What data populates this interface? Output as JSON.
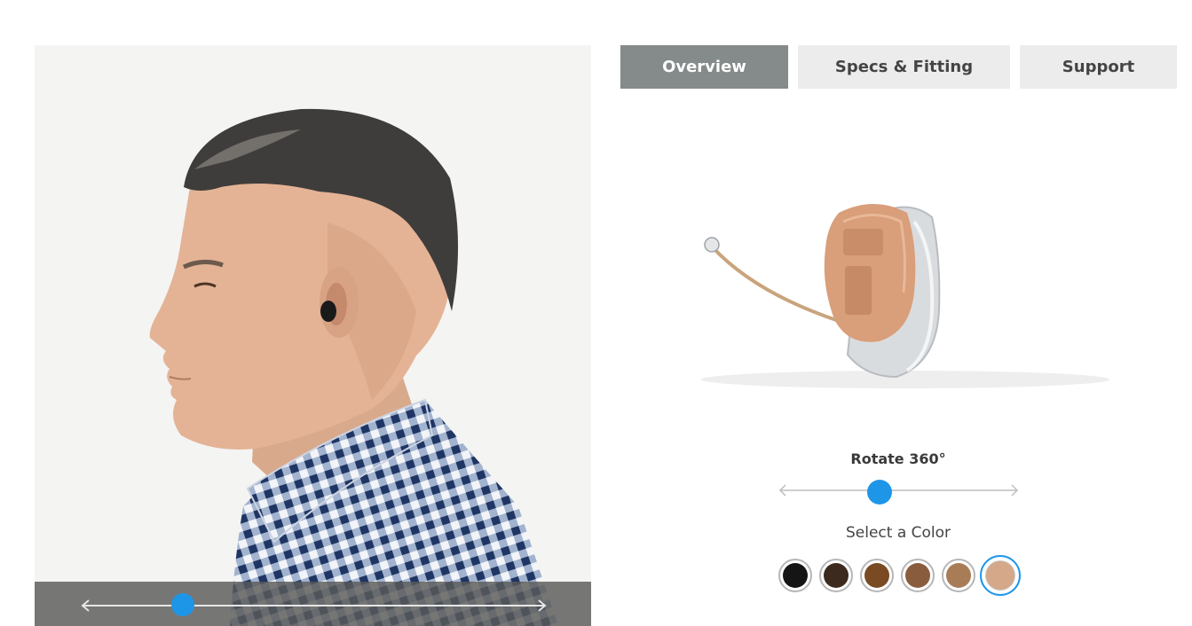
{
  "tabs": [
    {
      "label": "Overview",
      "active": true
    },
    {
      "label": "Specs & Fitting",
      "active": false
    },
    {
      "label": "Support",
      "active": false
    }
  ],
  "photo": {
    "subject": "man-profile-with-hearing-aid",
    "slider_position": 0.22
  },
  "rotate": {
    "label": "Rotate 360°",
    "position": 0.43
  },
  "color_picker": {
    "label": "Select a Color",
    "swatches": [
      {
        "name": "black",
        "color": "#151515"
      },
      {
        "name": "dark-brown",
        "color": "#3b2a1d"
      },
      {
        "name": "brown",
        "color": "#7a4a22"
      },
      {
        "name": "medium-brown",
        "color": "#8a5c3e"
      },
      {
        "name": "light-brown",
        "color": "#a97c58"
      },
      {
        "name": "beige",
        "color": "#d4a888",
        "selected": true
      }
    ]
  },
  "colors": {
    "accent": "#1e96e8",
    "tab_active": "#858a8a",
    "tab_inactive": "#ececec"
  }
}
